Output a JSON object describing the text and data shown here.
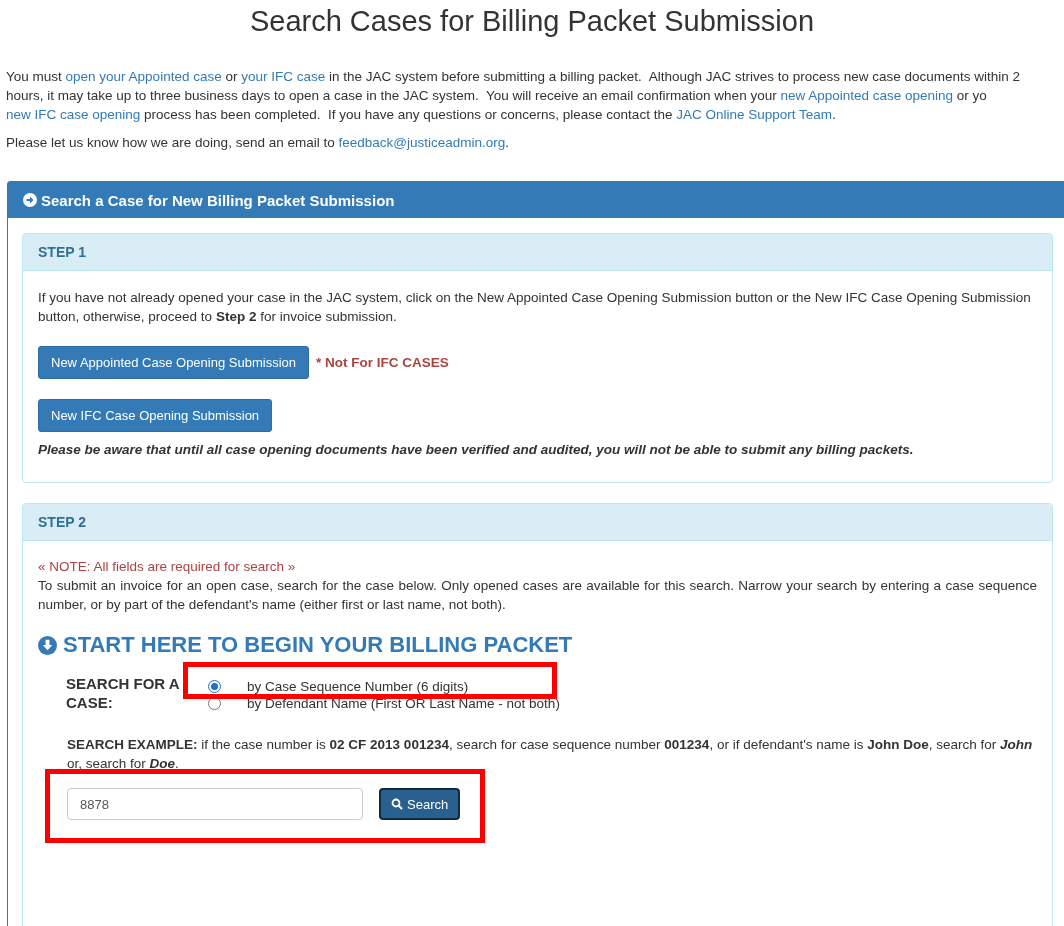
{
  "page_title": "Search Cases for Billing Packet Submission",
  "intro": [
    [
      {
        "text": "You must "
      },
      {
        "text": "open your Appointed case",
        "link": true
      },
      {
        "text": " or "
      },
      {
        "text": "your IFC case",
        "link": true
      },
      {
        "text": " in the JAC system before submitting a billing packet.  Although JAC strives to process new case documents within 2"
      }
    ],
    [
      {
        "text": "hours, it may take up to three business days to open a case in the JAC system.  You will receive an email confirmation when your "
      },
      {
        "text": "new Appointed case opening",
        "link": true
      },
      {
        "text": " or yo"
      }
    ],
    [
      {
        "text": "new IFC case opening",
        "link": true
      },
      {
        "text": " process has been completed.  If you have any questions or concerns, please contact the "
      },
      {
        "text": "JAC Online Support Team",
        "link": true
      },
      {
        "text": "."
      }
    ]
  ],
  "feedback": [
    {
      "text": "Please let us know how we are doing, send an email to "
    },
    {
      "text": "feedback@justiceadmin.org",
      "link": true
    },
    {
      "text": "."
    }
  ],
  "panel_title": "Search a Case for New Billing Packet Submission",
  "step1": {
    "heading": "STEP 1",
    "text": "If you have not already opened your case in the JAC system, click on the New Appointed Case Opening Submission button or the New IFC Case Opening Submission button, otherwise, proceed to **Step 2** for invoice submission.",
    "buttons": [
      "New Appointed Case Opening Submission",
      "New IFC Case Opening Submission"
    ],
    "button_note": "* Not For IFC CASES",
    "warning": "Please be aware that until all case opening documents have been verified and audited, you will not be able to submit any billing packets."
  },
  "step2": {
    "heading": "STEP 2",
    "note": "« NOTE: All fields are required for search »",
    "text": "To submit an invoice for an open case, search for the case below. Only opened cases are available for this search. Narrow your search by entering a case sequence number, or by part of the defendant's name (either first or last name, not both).",
    "start_heading": "START HERE TO BEGIN YOUR BILLING PACKET",
    "search_for_label": "SEARCH FOR A CASE:",
    "options": [
      {
        "label": "by Case Sequence Number (6 digits)",
        "selected": true
      },
      {
        "label": "by Defendant Name (First OR Last Name - not both)",
        "selected": false
      }
    ],
    "example": "**SEARCH EXAMPLE:** if the case number is **02 CF 2013 001234**, search for case sequence number **001234**, or if defendant's name is **John Doe**, search for *John* or, search for *Doe*.",
    "input_value": "8878",
    "search_button": "Search"
  }
}
